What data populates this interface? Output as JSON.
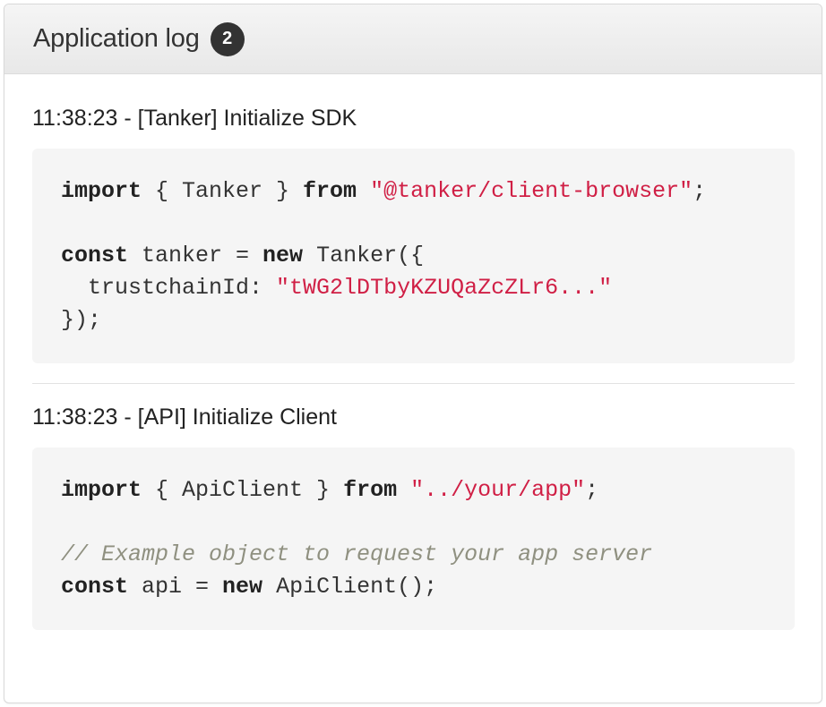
{
  "panel": {
    "title": "Application log",
    "badge_count": "2"
  },
  "entries": [
    {
      "title": "11:38:23 - [Tanker] Initialize SDK",
      "code": {
        "l1": {
          "kw1": "import",
          "t1": " { Tanker } ",
          "kw2": "from",
          "t2": " ",
          "str": "\"@tanker/client-browser\"",
          "t3": ";"
        },
        "l3": {
          "kw1": "const",
          "t1": " tanker = ",
          "kw2": "new",
          "t2": " Tanker({"
        },
        "l4": {
          "t1": "  trustchainId: ",
          "str": "\"tWG2lDTbyKZUQaZcZLr6...\""
        },
        "l5": {
          "t1": "});"
        }
      }
    },
    {
      "title": "11:38:23 - [API] Initialize Client",
      "code": {
        "l1": {
          "kw1": "import",
          "t1": " { ApiClient } ",
          "kw2": "from",
          "t2": " ",
          "str": "\"../your/app\"",
          "t3": ";"
        },
        "l3": {
          "comment": "// Example object to request your app server"
        },
        "l4": {
          "kw1": "const",
          "t1": " api = ",
          "kw2": "new",
          "t2": " ApiClient();"
        }
      }
    }
  ],
  "colors": {
    "string": "#d01f45",
    "comment": "#8f9080",
    "badge_bg": "#333333",
    "code_bg": "#f5f5f5"
  }
}
